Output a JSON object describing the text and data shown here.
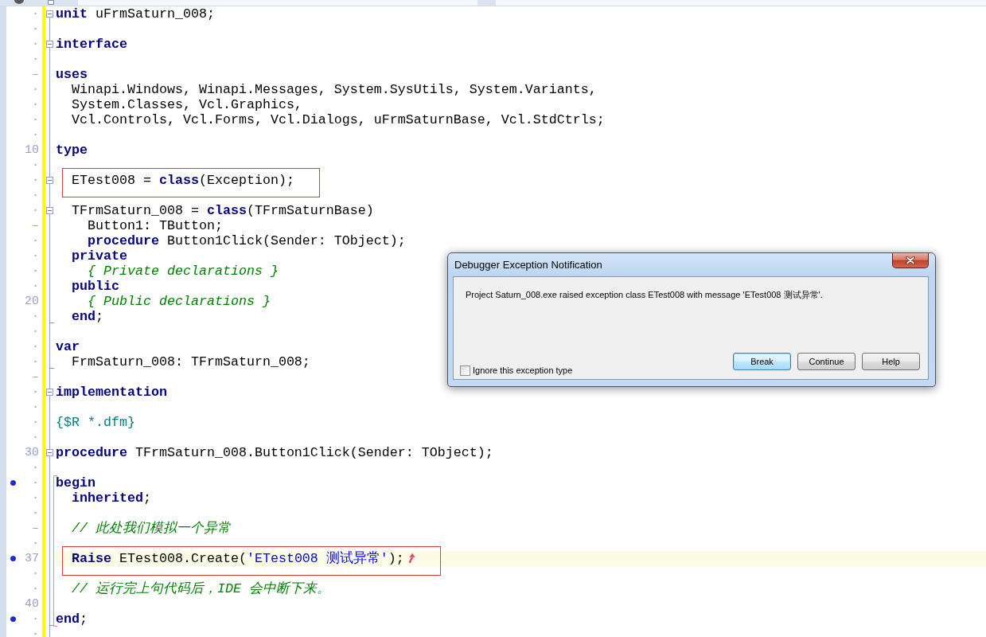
{
  "tab_strip": {
    "tabs": [
      {
        "selected": false
      },
      {
        "selected": false
      }
    ]
  },
  "editor": {
    "modified": true,
    "lines": [
      {
        "kind": "line",
        "gutter": "·",
        "foldable": true,
        "fold_end": false,
        "executable": false,
        "current": false,
        "boxed": false,
        "exception": false,
        "tokens": [
          {
            "kind": "keyword",
            "text": "unit"
          },
          {
            "kind": "plain",
            "text": " uFrmSaturn_008;"
          }
        ]
      },
      {
        "kind": "line",
        "gutter": "·",
        "foldable": false,
        "fold_end": false,
        "executable": false,
        "current": false,
        "boxed": false,
        "exception": false
      },
      {
        "kind": "line",
        "gutter": "·",
        "foldable": true,
        "fold_end": false,
        "executable": false,
        "current": false,
        "boxed": false,
        "exception": false,
        "tokens": [
          {
            "kind": "keyword",
            "text": "interface"
          }
        ]
      },
      {
        "kind": "line",
        "gutter": "·",
        "foldable": false,
        "fold_end": false,
        "executable": false,
        "current": false,
        "boxed": false,
        "exception": false
      },
      {
        "kind": "line",
        "gutter": "–",
        "foldable": false,
        "fold_end": false,
        "executable": false,
        "current": false,
        "boxed": false,
        "exception": false,
        "tokens": [
          {
            "kind": "keyword",
            "text": "uses"
          }
        ]
      },
      {
        "kind": "line",
        "gutter": "·",
        "foldable": false,
        "fold_end": false,
        "executable": false,
        "current": false,
        "boxed": false,
        "exception": false,
        "tokens": [
          {
            "kind": "plain",
            "text": "  Winapi.Windows, Winapi.Messages, System.SysUtils, System.Variants,"
          }
        ]
      },
      {
        "kind": "line",
        "gutter": "·",
        "foldable": false,
        "fold_end": false,
        "executable": false,
        "current": false,
        "boxed": false,
        "exception": false,
        "tokens": [
          {
            "kind": "plain",
            "text": "  System.Classes, Vcl.Graphics,"
          }
        ]
      },
      {
        "kind": "line",
        "gutter": "·",
        "foldable": false,
        "fold_end": false,
        "executable": false,
        "current": false,
        "boxed": false,
        "exception": false,
        "tokens": [
          {
            "kind": "plain",
            "text": "  Vcl.Controls, Vcl.Forms, Vcl.Dialogs, uFrmSaturnBase, Vcl.StdCtrls;"
          }
        ]
      },
      {
        "kind": "line",
        "gutter": "·",
        "foldable": false,
        "fold_end": false,
        "executable": false,
        "current": false,
        "boxed": false,
        "exception": false
      },
      {
        "kind": "line",
        "gutter": "10",
        "foldable": false,
        "fold_end": false,
        "executable": false,
        "current": false,
        "boxed": false,
        "exception": false,
        "tokens": [
          {
            "kind": "keyword",
            "text": "type"
          }
        ]
      },
      {
        "kind": "line",
        "gutter": "·",
        "foldable": false,
        "fold_end": false,
        "executable": false,
        "current": false,
        "boxed": false,
        "exception": false
      },
      {
        "kind": "line",
        "gutter": "·",
        "foldable": true,
        "fold_end": false,
        "executable": false,
        "current": false,
        "boxed": true,
        "exception": false,
        "tokens": [
          {
            "kind": "plain",
            "text": "  ETest008 = "
          },
          {
            "kind": "keyword",
            "text": "class"
          },
          {
            "kind": "plain",
            "text": "(Exception);"
          }
        ]
      },
      {
        "kind": "line",
        "gutter": "·",
        "foldable": false,
        "fold_end": false,
        "executable": false,
        "current": false,
        "boxed": false,
        "exception": false
      },
      {
        "kind": "line",
        "gutter": "·",
        "foldable": true,
        "fold_end": false,
        "executable": false,
        "current": false,
        "boxed": false,
        "exception": false,
        "tokens": [
          {
            "kind": "plain",
            "text": "  TFrmSaturn_008 = "
          },
          {
            "kind": "keyword",
            "text": "class"
          },
          {
            "kind": "plain",
            "text": "(TFrmSaturnBase)"
          }
        ]
      },
      {
        "kind": "line",
        "gutter": "–",
        "foldable": false,
        "fold_end": false,
        "executable": false,
        "current": false,
        "boxed": false,
        "exception": false,
        "tokens": [
          {
            "kind": "plain",
            "text": "    Button1: TButton;"
          }
        ]
      },
      {
        "kind": "line",
        "gutter": "·",
        "foldable": false,
        "fold_end": false,
        "executable": false,
        "current": false,
        "boxed": false,
        "exception": false,
        "tokens": [
          {
            "kind": "keyword",
            "text": "    procedure"
          },
          {
            "kind": "plain",
            "text": " Button1Click(Sender: TObject);"
          }
        ]
      },
      {
        "kind": "line",
        "gutter": "·",
        "foldable": false,
        "fold_end": false,
        "executable": false,
        "current": false,
        "boxed": false,
        "exception": false,
        "tokens": [
          {
            "kind": "keyword",
            "text": "  private"
          }
        ]
      },
      {
        "kind": "line",
        "gutter": "·",
        "foldable": false,
        "fold_end": false,
        "executable": false,
        "current": false,
        "boxed": false,
        "exception": false,
        "tokens": [
          {
            "kind": "comment",
            "text": "    { Private declarations }"
          }
        ]
      },
      {
        "kind": "line",
        "gutter": "·",
        "foldable": false,
        "fold_end": false,
        "executable": false,
        "current": false,
        "boxed": false,
        "exception": false,
        "tokens": [
          {
            "kind": "keyword",
            "text": "  public"
          }
        ]
      },
      {
        "kind": "line",
        "gutter": "20",
        "foldable": false,
        "fold_end": false,
        "executable": false,
        "current": false,
        "boxed": false,
        "exception": false,
        "tokens": [
          {
            "kind": "comment",
            "text": "    { Public declarations }"
          }
        ]
      },
      {
        "kind": "line",
        "gutter": "·",
        "foldable": false,
        "fold_end": true,
        "executable": false,
        "current": false,
        "boxed": false,
        "exception": false,
        "tokens": [
          {
            "kind": "keyword",
            "text": "  end"
          },
          {
            "kind": "plain",
            "text": ";"
          }
        ]
      },
      {
        "kind": "line",
        "gutter": "·",
        "foldable": false,
        "fold_end": false,
        "executable": false,
        "current": false,
        "boxed": false,
        "exception": false
      },
      {
        "kind": "line",
        "gutter": "·",
        "foldable": false,
        "fold_end": false,
        "executable": false,
        "current": false,
        "boxed": false,
        "exception": false,
        "tokens": [
          {
            "kind": "keyword",
            "text": "var"
          }
        ]
      },
      {
        "kind": "line",
        "gutter": "·",
        "foldable": false,
        "fold_end": true,
        "executable": false,
        "current": false,
        "boxed": false,
        "exception": false,
        "tokens": [
          {
            "kind": "plain",
            "text": "  FrmSaturn_008: TFrmSaturn_008;"
          }
        ]
      },
      {
        "kind": "line",
        "gutter": "–",
        "foldable": false,
        "fold_end": false,
        "executable": false,
        "current": false,
        "boxed": false,
        "exception": false
      },
      {
        "kind": "line",
        "gutter": "·",
        "foldable": true,
        "fold_end": false,
        "executable": false,
        "current": false,
        "boxed": false,
        "exception": false,
        "tokens": [
          {
            "kind": "keyword",
            "text": "implementation"
          }
        ]
      },
      {
        "kind": "line",
        "gutter": "·",
        "foldable": false,
        "fold_end": false,
        "executable": false,
        "current": false,
        "boxed": false,
        "exception": false
      },
      {
        "kind": "line",
        "gutter": "·",
        "foldable": false,
        "fold_end": false,
        "executable": false,
        "current": false,
        "boxed": false,
        "exception": false,
        "tokens": [
          {
            "kind": "directive",
            "text": "{$R *.dfm}"
          }
        ]
      },
      {
        "kind": "line",
        "gutter": "·",
        "foldable": false,
        "fold_end": false,
        "executable": false,
        "current": false,
        "boxed": false,
        "exception": false
      },
      {
        "kind": "line",
        "gutter": "30",
        "foldable": true,
        "fold_end": false,
        "executable": false,
        "current": false,
        "boxed": false,
        "exception": false,
        "tokens": [
          {
            "kind": "keyword",
            "text": "procedure"
          },
          {
            "kind": "plain",
            "text": " TFrmSaturn_008.Button1Click(Sender: TObject);"
          }
        ]
      },
      {
        "kind": "line",
        "gutter": "·",
        "foldable": false,
        "fold_end": false,
        "executable": false,
        "current": false,
        "boxed": false,
        "exception": false
      },
      {
        "kind": "block",
        "lines": [
          {
            "gutter": "·",
            "foldable": false,
            "fold_end": false,
            "executable": true,
            "current": false,
            "boxed": false,
            "exception": false,
            "tokens": [
              {
                "kind": "keyword",
                "text": "begin"
              }
            ]
          },
          {
            "gutter": "·",
            "foldable": false,
            "fold_end": false,
            "executable": false,
            "current": false,
            "boxed": false,
            "exception": false,
            "tokens": [
              {
                "kind": "keyword",
                "text": "  inherited"
              },
              {
                "kind": "plain",
                "text": ";"
              }
            ]
          },
          {
            "gutter": "·",
            "foldable": false,
            "fold_end": false,
            "executable": false,
            "current": false,
            "boxed": false,
            "exception": false
          },
          {
            "gutter": "–",
            "foldable": false,
            "fold_end": false,
            "executable": false,
            "current": false,
            "boxed": false,
            "exception": false,
            "tokens": [
              {
                "kind": "comment",
                "text": "  // 此处我们模拟一个异常"
              }
            ]
          },
          {
            "gutter": "·",
            "foldable": false,
            "fold_end": false,
            "executable": false,
            "current": false,
            "boxed": false,
            "exception": false
          },
          {
            "gutter": "37",
            "foldable": false,
            "fold_end": false,
            "executable": true,
            "current": true,
            "boxed": true,
            "exception": true,
            "tokens": [
              {
                "kind": "keyword",
                "text": "  Raise"
              },
              {
                "kind": "plain",
                "text": " ETest008.Create("
              },
              {
                "kind": "string",
                "text": "'ETest008 测试异常'"
              },
              {
                "kind": "plain",
                "text": ");"
              }
            ]
          },
          {
            "gutter": "·",
            "foldable": false,
            "fold_end": false,
            "executable": false,
            "current": false,
            "boxed": false,
            "exception": false
          },
          {
            "gutter": "·",
            "foldable": false,
            "fold_end": false,
            "executable": false,
            "current": false,
            "boxed": false,
            "exception": false,
            "tokens": [
              {
                "kind": "comment",
                "text": "  // 运行完上句代码后，IDE 会中断下来。"
              }
            ]
          },
          {
            "gutter": "40",
            "foldable": false,
            "fold_end": false,
            "executable": false,
            "current": false,
            "boxed": false,
            "exception": false
          },
          {
            "gutter": "·",
            "foldable": false,
            "fold_end": true,
            "executable": true,
            "current": false,
            "boxed": false,
            "exception": false,
            "tokens": [
              {
                "kind": "keyword",
                "text": "end"
              },
              {
                "kind": "plain",
                "text": ";"
              }
            ]
          }
        ]
      },
      {
        "kind": "line",
        "gutter": "·",
        "foldable": false,
        "fold_end": false,
        "executable": false,
        "current": false,
        "boxed": false,
        "exception": false
      }
    ]
  },
  "dialog": {
    "title": "Debugger Exception Notification",
    "message": "Project Saturn_008.exe raised exception class ETest008 with message 'ETest008 测试异常'.",
    "checkbox": {
      "label": "Ignore this exception type",
      "checked": false
    },
    "buttons": [
      {
        "label": "Break",
        "focused": true
      },
      {
        "label": "Continue",
        "focused": false
      },
      {
        "label": "Help",
        "focused": false
      }
    ]
  }
}
